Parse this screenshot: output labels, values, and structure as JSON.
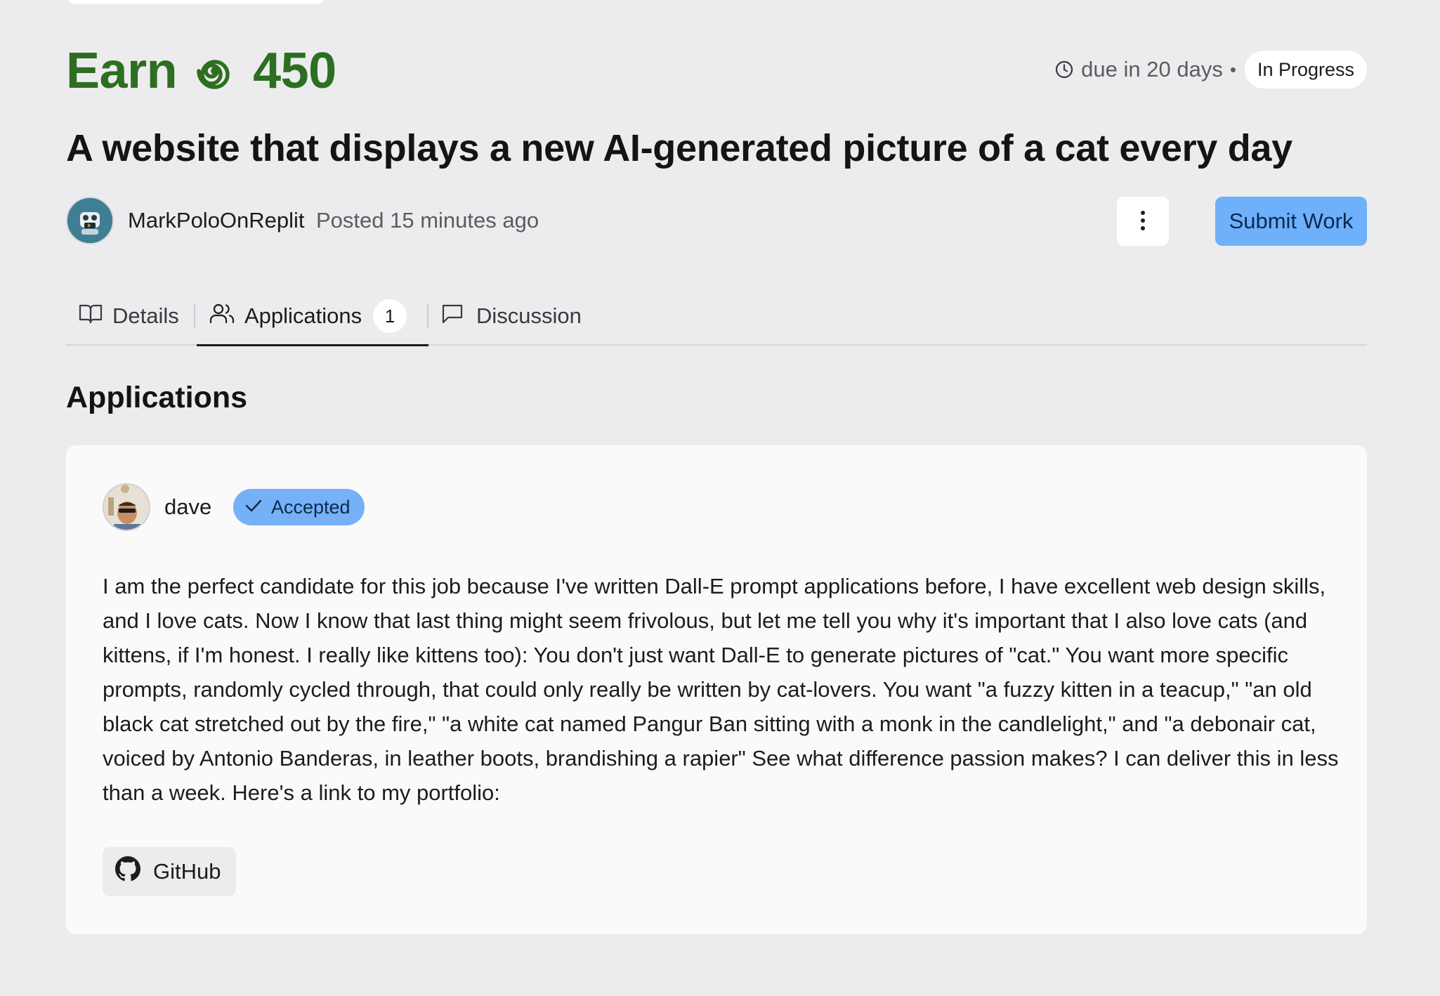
{
  "bounty": {
    "earn_label": "Earn",
    "amount": "450",
    "due": "due in 20 days",
    "separator": "•",
    "status": "In Progress",
    "title": "A website that displays a new AI-generated picture of a cat every day"
  },
  "author": {
    "name": "MarkPoloOnReplit",
    "posted": "Posted 15 minutes ago"
  },
  "actions": {
    "more_icon": "more-vertical-icon",
    "submit_label": "Submit Work"
  },
  "tabs": [
    {
      "label": "Details",
      "icon": "book-open-icon"
    },
    {
      "label": "Applications",
      "icon": "users-icon",
      "count": "1",
      "active": true
    },
    {
      "label": "Discussion",
      "icon": "message-square-icon"
    }
  ],
  "applications": {
    "heading": "Applications",
    "items": [
      {
        "name": "dave",
        "status": "Accepted",
        "body": "I am the perfect candidate for this job because I've written Dall-E prompt applications before, I have excellent web design skills, and I love cats. Now I know that last thing might seem frivolous, but let me tell you why it's important that I also love cats (and kittens, if I'm honest. I really like kittens too): You don't just want Dall-E to generate pictures of \"cat.\" You want more specific prompts, randomly cycled through, that could only really be written by cat-lovers. You want \"a fuzzy kitten in a teacup,\" \"an old black cat stretched out by the fire,\" \"a white cat named Pangur Ban sitting with a monk in the candlelight,\" and \"a debonair cat, voiced by Antonio Banderas, in leather boots, brandishing a rapier\" See what difference passion makes? I can deliver this in less than a week. Here's a link to my portfolio:",
        "link_label": "GitHub"
      }
    ]
  },
  "colors": {
    "earn_green": "#2d6f20",
    "accent_blue": "#6fb0fb",
    "background": "#ececee",
    "card": "#fafafa"
  }
}
